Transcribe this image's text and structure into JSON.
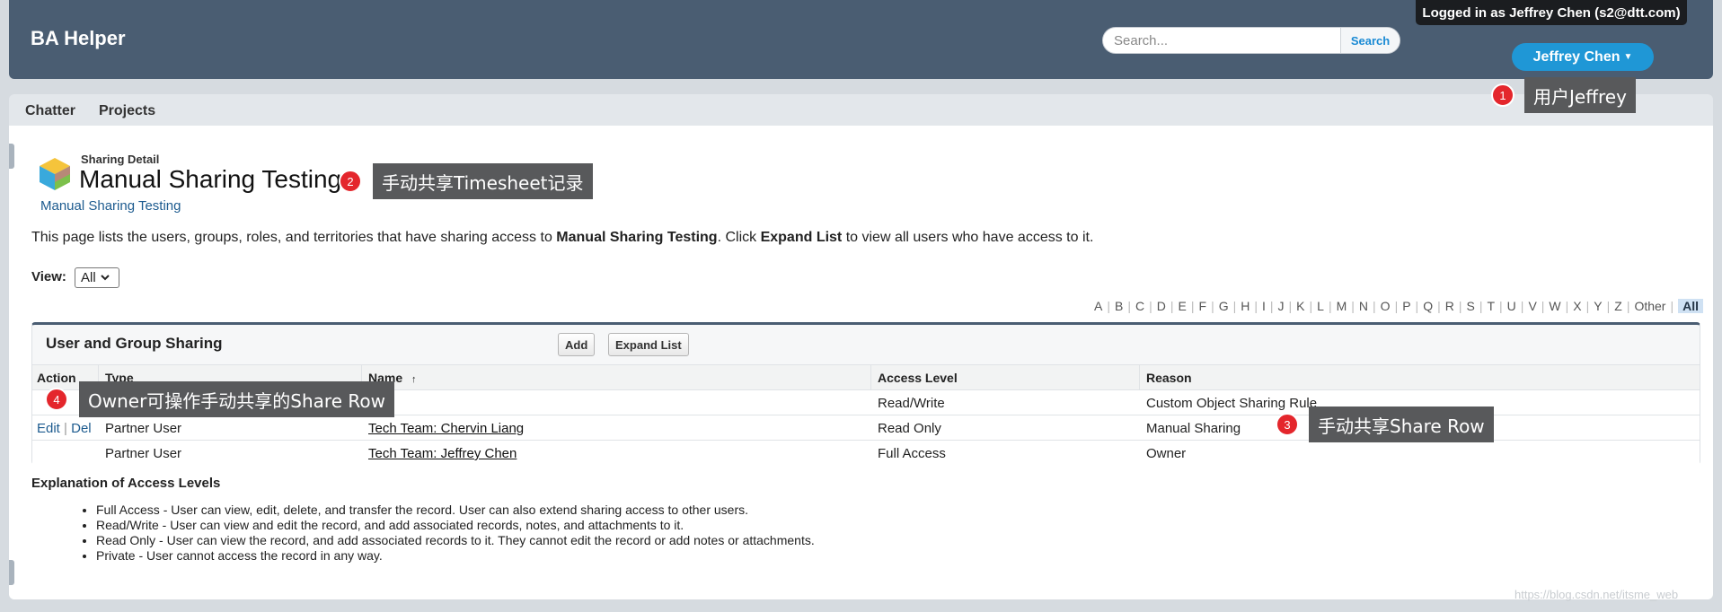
{
  "header": {
    "app_title": "BA Helper",
    "search_placeholder": "Search...",
    "search_button": "Search",
    "logged_in_text": "Logged in as Jeffrey Chen (s2@dtt.com)",
    "user_menu_label": "Jeffrey Chen"
  },
  "nav": {
    "items": [
      {
        "label": "Chatter"
      },
      {
        "label": "Projects"
      }
    ]
  },
  "record": {
    "type_label": "Sharing Detail",
    "title": "Manual Sharing Testing",
    "link": "Manual Sharing Testing"
  },
  "intro": {
    "part1": "This page lists the users, groups, roles, and territories that have sharing access to ",
    "record_name": "Manual Sharing Testing",
    "part2": ". Click ",
    "expand_text": "Expand List",
    "part3": " to view all users who have access to it."
  },
  "view": {
    "label": "View:",
    "selected": "All"
  },
  "alpha_filter": [
    "A",
    "B",
    "C",
    "D",
    "E",
    "F",
    "G",
    "H",
    "I",
    "J",
    "K",
    "L",
    "M",
    "N",
    "O",
    "P",
    "Q",
    "R",
    "S",
    "T",
    "U",
    "V",
    "W",
    "X",
    "Y",
    "Z",
    "Other",
    "All"
  ],
  "alpha_active": "All",
  "sharing": {
    "title": "User and Group Sharing",
    "add_button": "Add",
    "expand_button": "Expand List",
    "columns": {
      "action": "Action",
      "type": "Type",
      "name": "Name",
      "sort_indicator": "↑",
      "access": "Access Level",
      "reason": "Reason"
    },
    "rows": [
      {
        "action_edit": "",
        "action_del": "",
        "type": "",
        "name": "",
        "access": "Read/Write",
        "reason": "Custom Object Sharing Rule"
      },
      {
        "action_edit": "Edit",
        "action_del": "Del",
        "type": "Partner User",
        "name": "Tech Team: Chervin Liang",
        "access": "Read Only",
        "reason": "Manual Sharing"
      },
      {
        "action_edit": "",
        "action_del": "",
        "type": "Partner User",
        "name": "Tech Team: Jeffrey Chen",
        "access": "Full Access",
        "reason": "Owner"
      }
    ]
  },
  "explanation": {
    "title": "Explanation of Access Levels",
    "items": [
      "Full Access - User can view, edit, delete, and transfer the record. User can also extend sharing access to other users.",
      "Read/Write - User can view and edit the record, and add associated records, notes, and attachments to it.",
      "Read Only - User can view the record, and add associated records to it. They cannot edit the record or add notes or attachments.",
      "Private - User cannot access the record in any way."
    ]
  },
  "annotations": [
    {
      "number": "1",
      "text": "用户Jeffrey"
    },
    {
      "number": "2",
      "text": "手动共享Timesheet记录"
    },
    {
      "number": "3",
      "text": "手动共享Share Row"
    },
    {
      "number": "4",
      "text": "Owner可操作手动共享的Share Row"
    }
  ],
  "watermark": "https://blog.csdn.net/itsme_web",
  "colors": {
    "header_bg": "#4a5d72",
    "user_button": "#1f97d6",
    "link": "#1d5b8f",
    "badge": "#e4262c",
    "note_bg": "#58595b"
  }
}
